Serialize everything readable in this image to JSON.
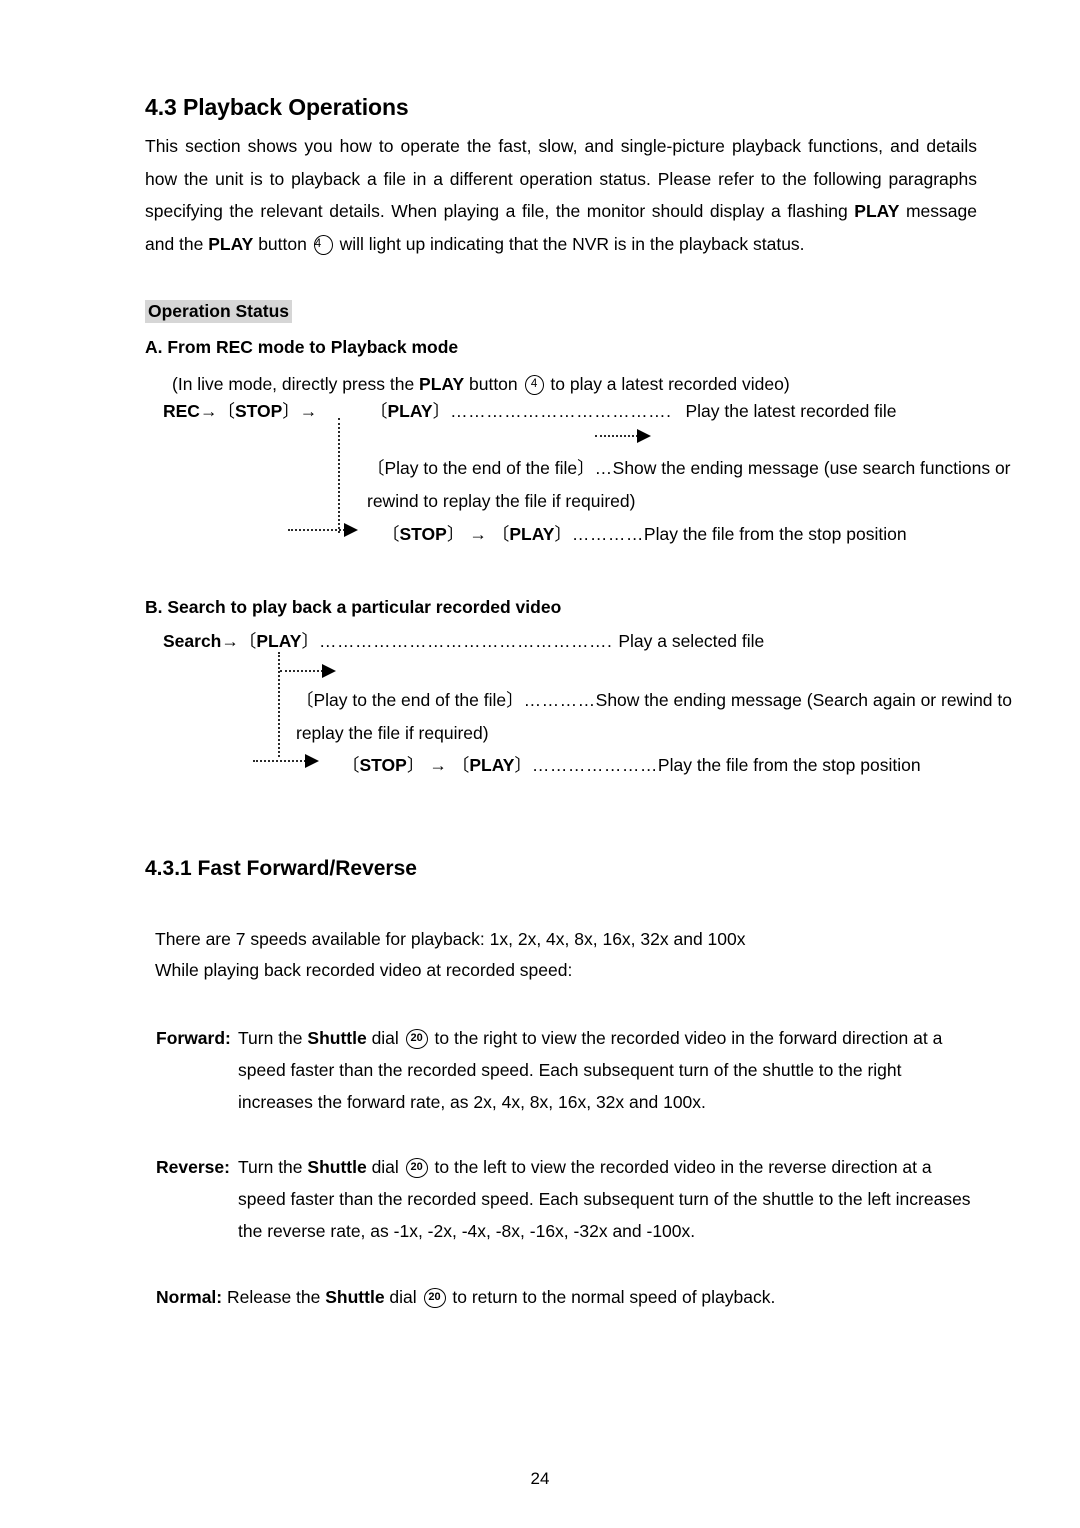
{
  "document": {
    "section_number_title": "4.3 Playback Operations",
    "intro_paragraph": "This section shows you how to operate the fast, slow, and single-picture playback functions, and details how the unit is to playback a file in a different operation status. Please refer to the following paragraphs specifying the relevant details. When playing a file, the monitor should display a flashing ",
    "intro_bold_1": "PLAY",
    "intro_paragraph_2": " message and the ",
    "intro_bold_2": "PLAY",
    "intro_paragraph_3": " button ",
    "intro_badge": "4",
    "intro_paragraph_4": " will light up indicating that the NVR is in the playback status.",
    "operation_status_label": "Operation Status",
    "page_number": "24"
  },
  "section_a": {
    "heading": "A. From REC mode to Playback mode",
    "note": "(In live mode, directly press the ",
    "note_bold": "PLAY",
    "note_mid": " button ",
    "note_badge": "4",
    "note_end": " to play a latest recorded video)",
    "line1": {
      "rec": "REC",
      "arrow1": "→",
      "bracket_open": "〔",
      "stop": "STOP",
      "bracket_close": "〕",
      "arrow2": "→",
      "play_bracket_open": "〔",
      "play": "PLAY",
      "play_bracket_close": "〕",
      "dots": "……………………………….",
      "result": "Play the latest recorded file"
    },
    "line2": {
      "bracket_open": "〔",
      "text": "Play to the end of the file",
      "bracket_close": "〕",
      "dots": "…",
      "result": "Show the ending message (use search functions or rewind to replay the file if required)"
    },
    "line3": {
      "bracket_open": "〔",
      "stop": "STOP",
      "bracket_close": "〕",
      "arrow": "→",
      "play_bracket_open": "〔",
      "play": "PLAY",
      "play_bracket_close": "〕",
      "dots": "…………",
      "result": "Play the file from the stop position"
    }
  },
  "section_b": {
    "heading": "B. Search to play back a particular recorded video",
    "line1": {
      "search": "Search",
      "arrow": "→",
      "bracket_open": "〔",
      "play": "PLAY",
      "bracket_close": "〕",
      "dots": "………………………………………….",
      "result": "Play a selected file"
    },
    "line2": {
      "bracket_open": "〔",
      "text": "Play to the end of the file",
      "bracket_close": "〕",
      "dots": "…………",
      "result": "Show the ending message (Search again or rewind to replay the file if required)"
    },
    "line3": {
      "bracket_open": "〔",
      "stop": "STOP",
      "bracket_close": "〕",
      "arrow": "→",
      "play_bracket_open": "〔",
      "play": "PLAY",
      "play_bracket_close": "〕",
      "dots": "…………………",
      "result": "Play the file from the stop position"
    }
  },
  "section_431": {
    "heading": "4.3.1 Fast Forward/Reverse",
    "intro_line_1": "There are 7 speeds available for playback: 1x, 2x, 4x, 8x, 16x, 32x and 100x",
    "intro_line_2": "While playing back recorded video at recorded speed:",
    "forward": {
      "label": "Forward:",
      "text_a": " Turn the ",
      "bold": "Shuttle",
      "text_b": " dial ",
      "badge": "20",
      "text_c": " to the right to view the recorded video in the forward direction at a speed faster than the recorded speed. Each subsequent turn of the shuttle to the right increases the forward rate, as 2x, 4x, 8x, 16x, 32x and 100x."
    },
    "reverse": {
      "label": "Reverse:",
      "text_a": " Turn the ",
      "bold": "Shuttle",
      "text_b": " dial ",
      "badge": "20",
      "text_c": " to the left to view the recorded video in the reverse direction at a speed faster than the recorded speed. Each subsequent turn of the shuttle to the left increases the reverse rate, as -1x, -2x, -4x, -8x, -16x, -32x and -100x."
    },
    "normal": {
      "label": "Normal:",
      "text_a": "   Release the ",
      "bold": "Shuttle",
      "text_b": " dial ",
      "badge": "20",
      "text_c": " to return to the normal speed of playback."
    }
  }
}
